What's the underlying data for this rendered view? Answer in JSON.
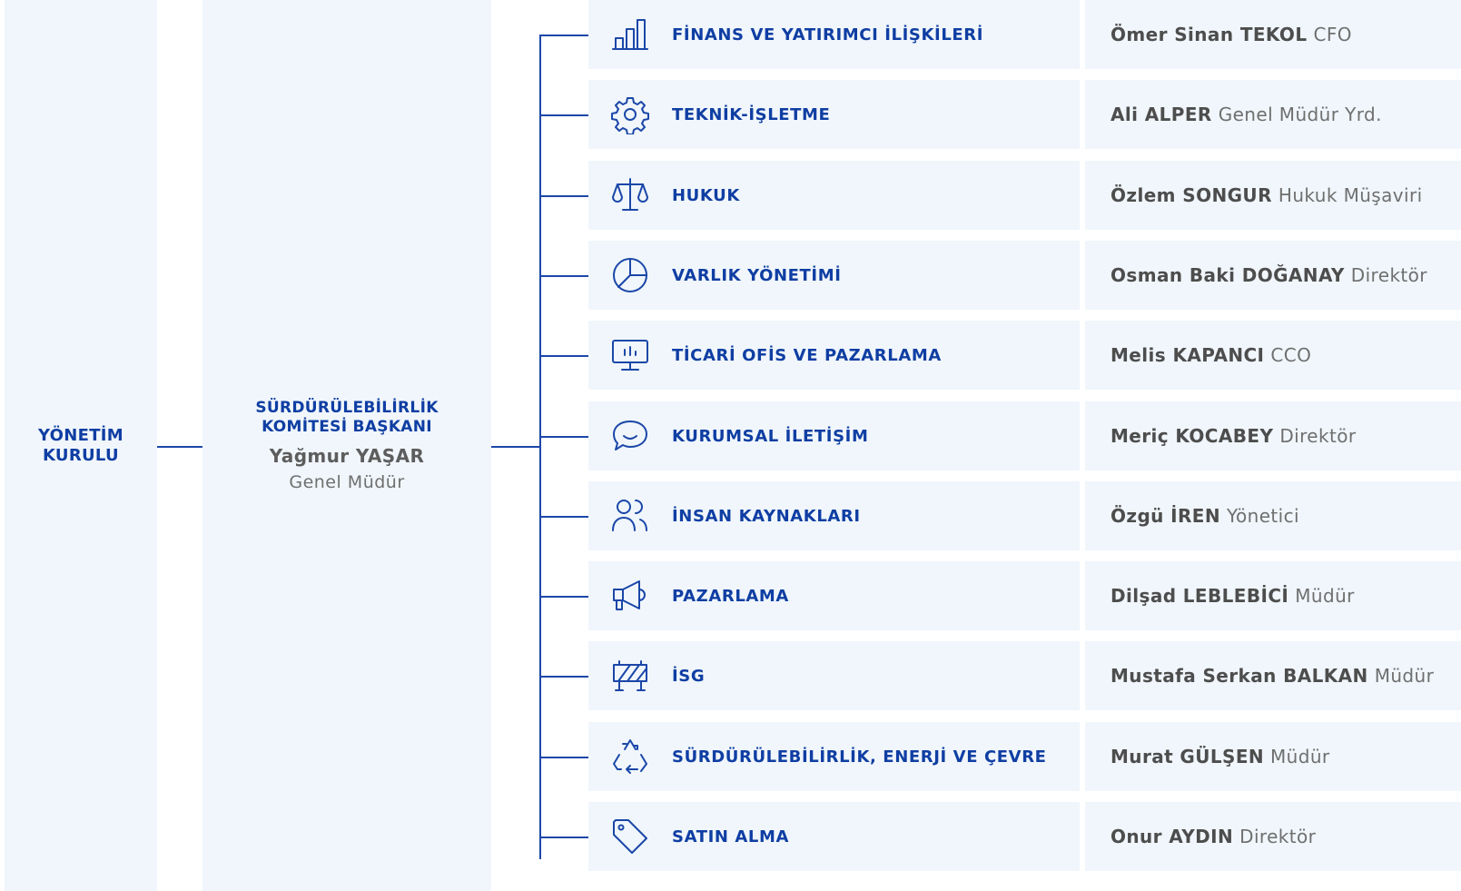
{
  "board": {
    "title": "YÖNETİM\nKURULU"
  },
  "chair": {
    "title": "SÜRDÜRÜLEBİLİRLİK\nKOMİTESİ BAŞKANI",
    "name": "Yağmur YAŞAR",
    "role": "Genel Müdür"
  },
  "colors": {
    "accent": "#0f3ea3",
    "panel": "#f0f6fb",
    "line": "#1b47a8"
  },
  "departments": [
    {
      "label": "FİNANS VE YATIRIMCI İLİŞKİLERİ",
      "icon": "bar-chart-icon",
      "person": "Ömer Sinan TEKOL",
      "role": "CFO"
    },
    {
      "label": "TEKNİK-İŞLETME",
      "icon": "gear-icon",
      "person": "Ali ALPER",
      "role": "Genel Müdür Yrd."
    },
    {
      "label": "HUKUK",
      "icon": "scales-icon",
      "person": "Özlem SONGUR",
      "role": "Hukuk Müşaviri"
    },
    {
      "label": "VARLIK YÖNETİMİ",
      "icon": "pie-chart-icon",
      "person": "Osman Baki DOĞANAY",
      "role": "Direktör"
    },
    {
      "label": "TİCARİ OFİS VE PAZARLAMA",
      "icon": "monitor-chart-icon",
      "person": "Melis KAPANCI",
      "role": "CCO"
    },
    {
      "label": "KURUMSAL İLETİŞİM",
      "icon": "chat-bubble-icon",
      "person": "Meriç KOCABEY",
      "role": "Direktör"
    },
    {
      "label": "İNSAN KAYNAKLARI",
      "icon": "users-icon",
      "person": "Özgü İREN",
      "role": "Yönetici"
    },
    {
      "label": "PAZARLAMA",
      "icon": "megaphone-icon",
      "person": "Dilşad LEBLEBİCİ",
      "role": "Müdür"
    },
    {
      "label": "İSG",
      "icon": "barrier-icon",
      "person": "Mustafa Serkan BALKAN",
      "role": "Müdür"
    },
    {
      "label": "SÜRDÜRÜLEBİLİRLİK, ENERJİ VE ÇEVRE",
      "icon": "recycle-icon",
      "person": "Murat GÜLŞEN",
      "role": "Müdür"
    },
    {
      "label": "SATIN ALMA",
      "icon": "tag-icon",
      "person": "Onur AYDIN",
      "role": "Direktör"
    }
  ]
}
